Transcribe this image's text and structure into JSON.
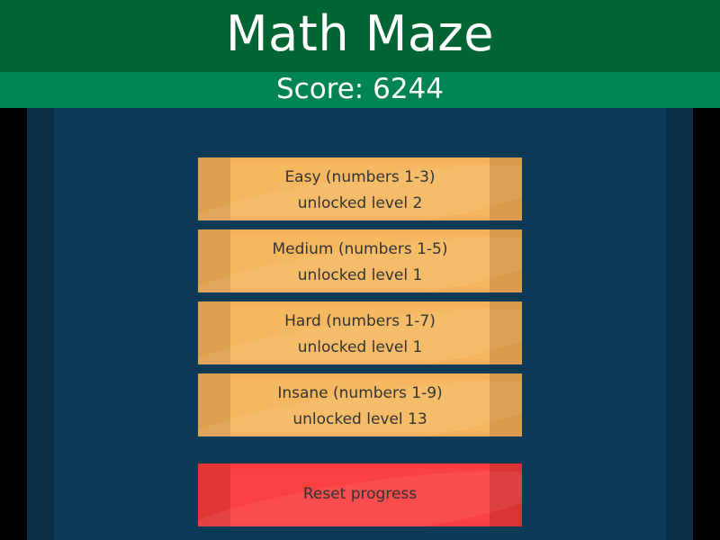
{
  "header": {
    "title": "Math Maze",
    "score": "Score: 6244"
  },
  "levels": [
    {
      "name": "Easy (numbers 1-3)",
      "status": "unlocked level 2"
    },
    {
      "name": "Medium (numbers 1-5)",
      "status": "unlocked level 1"
    },
    {
      "name": "Hard (numbers 1-7)",
      "status": "unlocked level 1"
    },
    {
      "name": "Insane (numbers 1-9)",
      "status": "unlocked level 13"
    }
  ],
  "reset": {
    "label": "Reset progress"
  },
  "colors": {
    "title_bar": "#006532",
    "score_bar": "#008451",
    "board": "#0d3a57",
    "level_button": "#f3b25a",
    "reset_button": "#f73d3d"
  }
}
